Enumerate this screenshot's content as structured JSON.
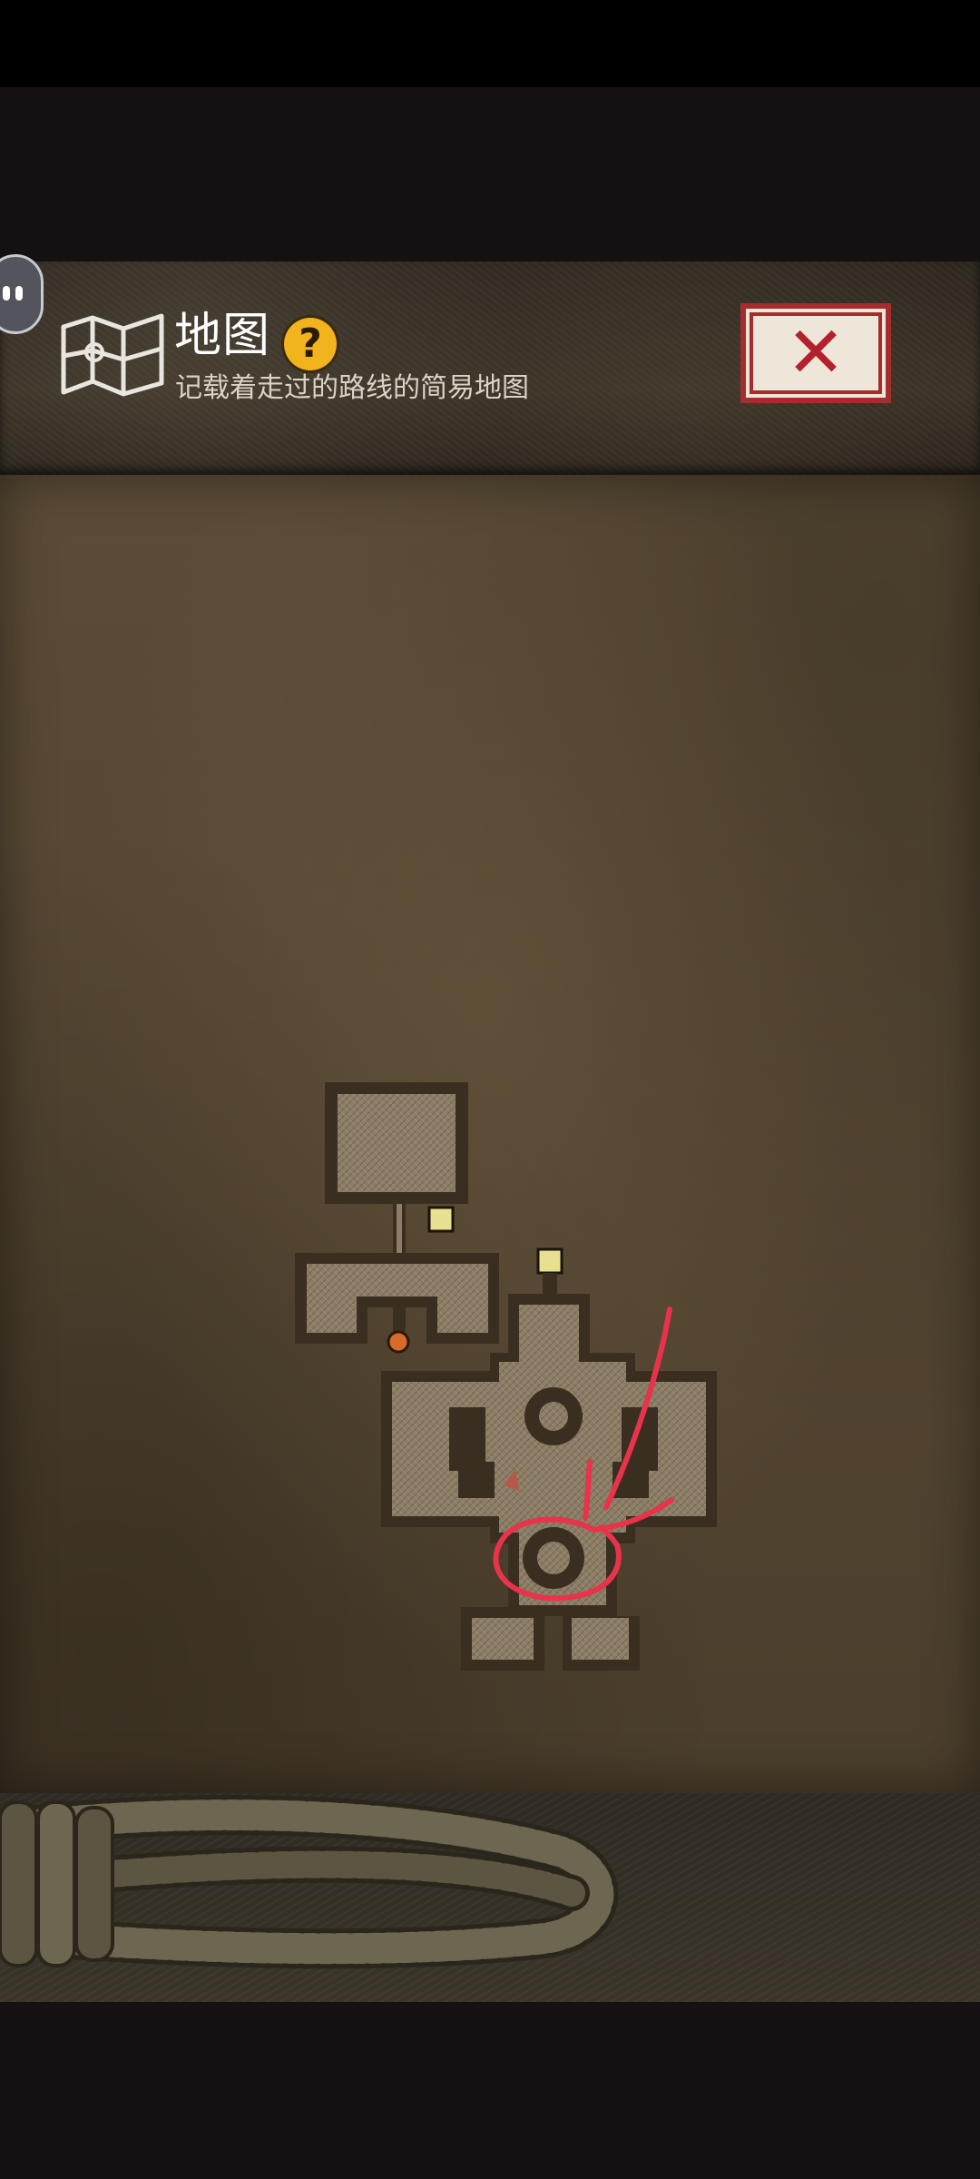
{
  "header": {
    "title": "地图",
    "help_glyph": "?",
    "subtitle": "记载着走过的路线的简易地图",
    "close_glyph": "✕"
  },
  "icons": {
    "map": "map-icon",
    "help": "question-icon",
    "close": "close-icon",
    "float": "floating-assistant-icon",
    "save_point": "save-point-icon",
    "door": "door-icon",
    "player": "player-arrow-icon"
  },
  "colors": {
    "close_border": "#a62d2d",
    "help_badge": "#f2b41c",
    "annotation": "#e8334a",
    "parchment": "#564733"
  }
}
